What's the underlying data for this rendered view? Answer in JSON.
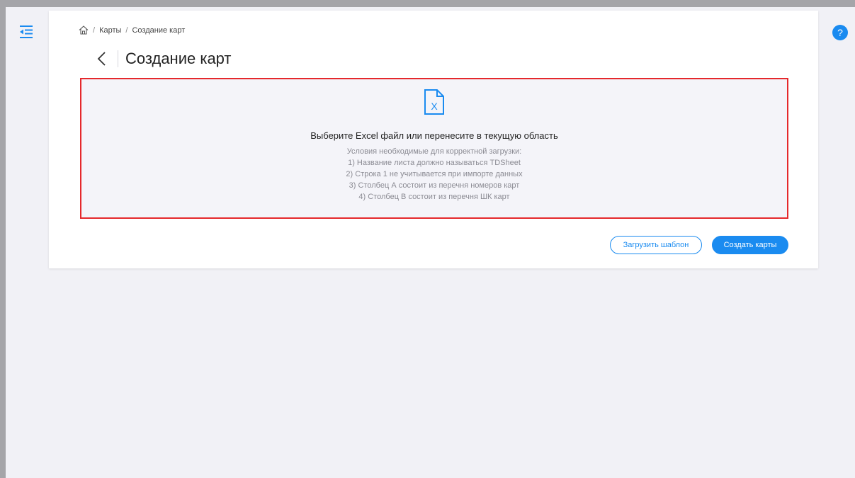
{
  "header": {
    "menu_icon": "menu-collapse-icon",
    "help_label": "?"
  },
  "breadcrumb": {
    "home_icon": "home-icon",
    "separator": "/",
    "items": [
      "Карты",
      "Создание карт"
    ]
  },
  "page": {
    "title": "Создание карт",
    "back_icon": "chevron-left-icon"
  },
  "dropzone": {
    "icon": "excel-file-icon",
    "icon_letter": "X",
    "title": "Выберите Excel файл или перенесите в текущую область",
    "conditions_heading": "Условия необходимые для корректной загрузки:",
    "conditions": [
      "1) Название листа должно называться TDSheet",
      "2) Строка 1 не учитывается при импорте данных",
      "3) Столбец А состоит из перечня номеров карт",
      "4) Столбец В состоит из перечня ШК карт"
    ]
  },
  "actions": {
    "load_template_label": "Загрузить шаблон",
    "create_cards_label": "Создать карты"
  },
  "colors": {
    "accent": "#1a8bf0",
    "highlight_border": "#e5282c",
    "background": "#f1f1f6"
  }
}
